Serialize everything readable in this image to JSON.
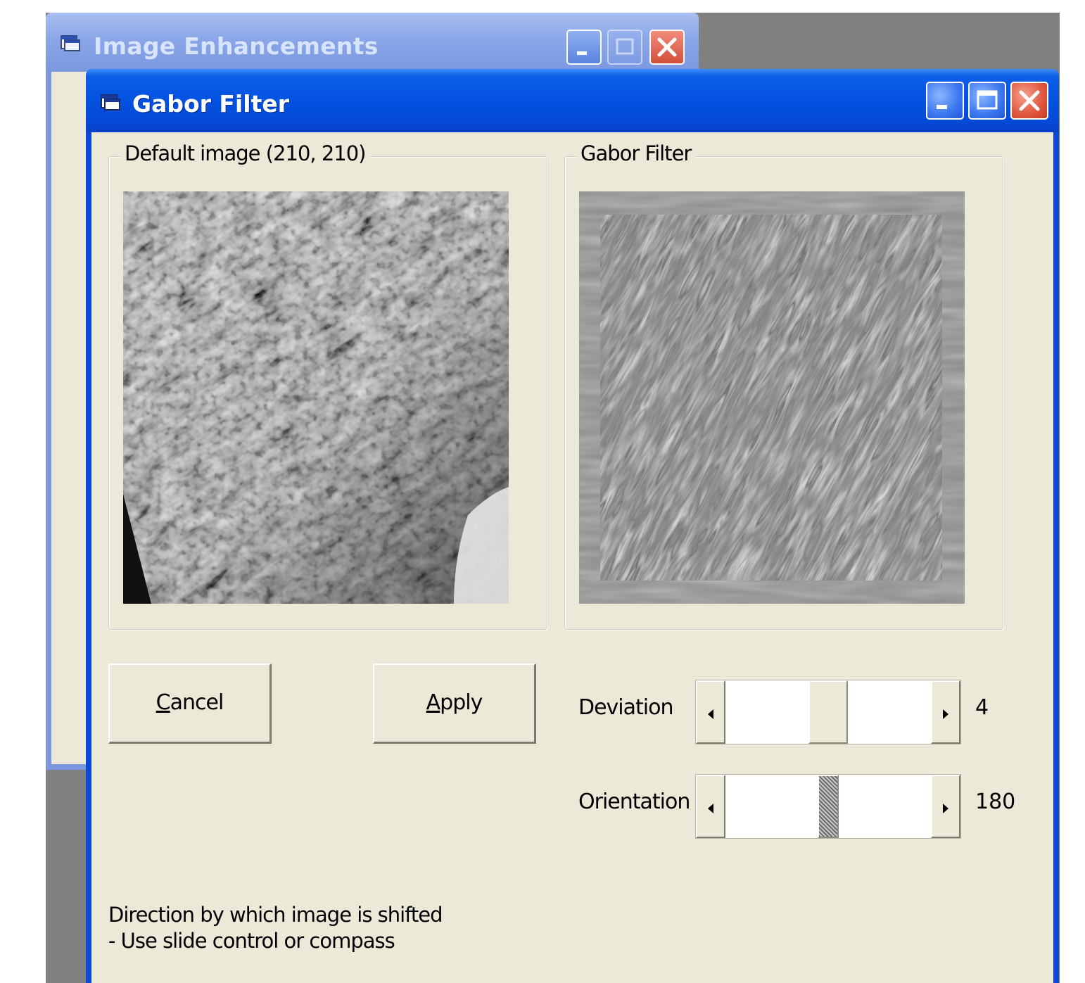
{
  "back_window": {
    "title": "Image Enhancements",
    "icon": "window-app-icon"
  },
  "window": {
    "title": "Gabor Filter",
    "icon": "window-app-icon",
    "buttons": {
      "minimize": "minimize-icon",
      "maximize": "maximize-icon",
      "close": "close-icon"
    }
  },
  "default_group": {
    "label": "Default image (210, 210)"
  },
  "gabor_group": {
    "label": "Gabor Filter"
  },
  "buttons": {
    "cancel": {
      "label": "Cancel",
      "accel_index": 0
    },
    "apply": {
      "label": "Apply",
      "accel_index": 0
    }
  },
  "deviation": {
    "label": "Deviation",
    "value": "4",
    "position": 0.5
  },
  "orientation": {
    "label": "Orientation",
    "value": "180",
    "position": 0.5
  },
  "help": {
    "line1": "Direction by which image is shifted",
    "line2": "- Use slide control or compass"
  },
  "colors": {
    "titlebar_active": "#0352e0",
    "titlebar_inactive": "#8aa6e8",
    "client_bg": "#ece9d8",
    "close_button": "#e1573d"
  }
}
